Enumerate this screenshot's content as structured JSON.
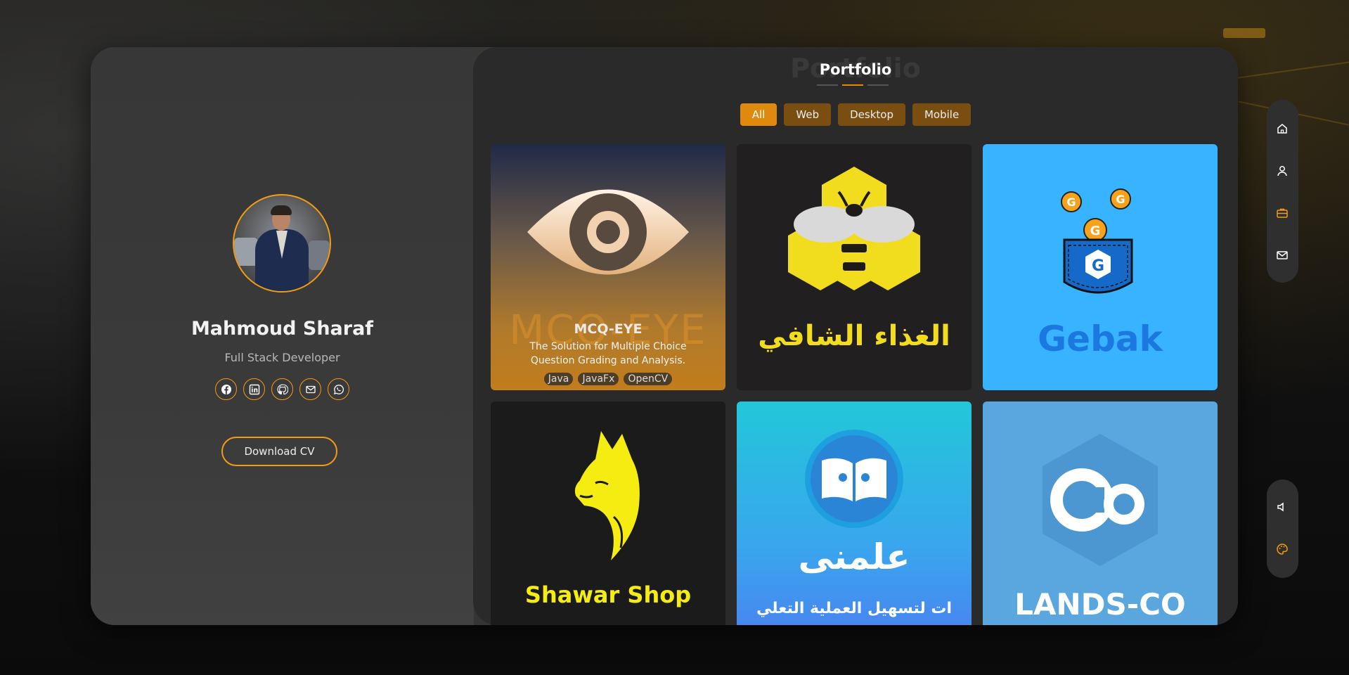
{
  "profile": {
    "name": "Mahmoud Sharaf",
    "role": "Full Stack Developer",
    "download_cv_label": "Download CV",
    "socials": [
      "facebook-icon",
      "linkedin-icon",
      "github-icon",
      "mail-icon",
      "whatsapp-icon"
    ]
  },
  "portfolio": {
    "title": "Portfolio",
    "ghost_title": "Portfolio",
    "filters": [
      {
        "label": "All",
        "active": true
      },
      {
        "label": "Web",
        "active": false
      },
      {
        "label": "Desktop",
        "active": false
      },
      {
        "label": "Mobile",
        "active": false
      }
    ],
    "projects": [
      {
        "logo_text": "MCQ-EYE",
        "title": "MCQ-EYE",
        "description": "The Solution for Multiple Choice Question Grading and Analysis.",
        "tags": [
          "Java",
          "JavaFx",
          "OpenCV"
        ]
      },
      {
        "logo_text": "الغذاء الشافي"
      },
      {
        "logo_text": "Gebak"
      },
      {
        "logo_text": "Shawar Shop"
      },
      {
        "logo_text": "علمنى",
        "subtitle": "ات لتسهيل العملية التعلي"
      },
      {
        "logo_text": "LANDS-CO"
      }
    ]
  },
  "nav": {
    "items": [
      "home-icon",
      "user-icon",
      "briefcase-icon",
      "mail-icon"
    ],
    "active": "briefcase-icon",
    "tools": [
      "volume-icon",
      "palette-icon"
    ]
  },
  "colors": {
    "accent": "#f39c12",
    "panel": "#2a2a2a",
    "frame": "#3a3a3a"
  }
}
